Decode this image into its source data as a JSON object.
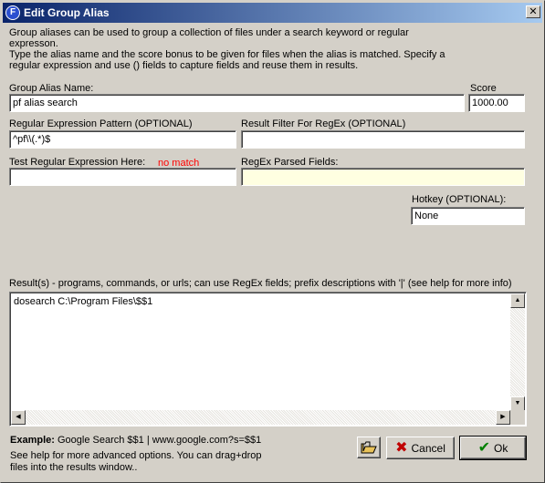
{
  "window": {
    "title": "Edit Group Alias",
    "app_icon_letter": "F"
  },
  "description": {
    "line1": "Group aliases can be used to group a collection of files under a search keyword or regular",
    "line2": "expresson.",
    "line3": "Type the alias name and the score bonus to be given for files when the alias is matched.  Specify a",
    "line4": "regular expression and use () fields to capture fields and reuse them in results."
  },
  "alias_name": {
    "label": "Group Alias Name:",
    "value": "pf alias search"
  },
  "score": {
    "label": "Score",
    "value": "1000.00"
  },
  "regex_pattern": {
    "label": "Regular Expression Pattern (OPTIONAL)",
    "value": "^pf\\\\(.*)$"
  },
  "result_filter": {
    "label": "Result Filter For RegEx (OPTIONAL)",
    "value": ""
  },
  "test_regex": {
    "label": "Test Regular Expression Here:",
    "status": "no match",
    "value": ""
  },
  "parsed_fields": {
    "label": "RegEx Parsed Fields:",
    "value": ""
  },
  "hotkey": {
    "label": "Hotkey (OPTIONAL):",
    "value": "None"
  },
  "results": {
    "label": "Result(s) - programs, commands, or urls; can use RegEx fields; prefix descriptions with '|' (see help for more info)",
    "value": "dosearch C:\\Program Files\\$$1"
  },
  "example": {
    "bold": "Example:",
    "text": " Google Search $$1 | www.google.com?s=$$1"
  },
  "help": {
    "line1": "See help for more advanced options.  You can drag+drop",
    "line2": "files into the results window.."
  },
  "buttons": {
    "cancel": "Cancel",
    "ok": "Ok"
  },
  "colors": {
    "status_red": "#ff0000",
    "parsed_bg": "#ffffe1",
    "titlebar": "#0a246a"
  }
}
